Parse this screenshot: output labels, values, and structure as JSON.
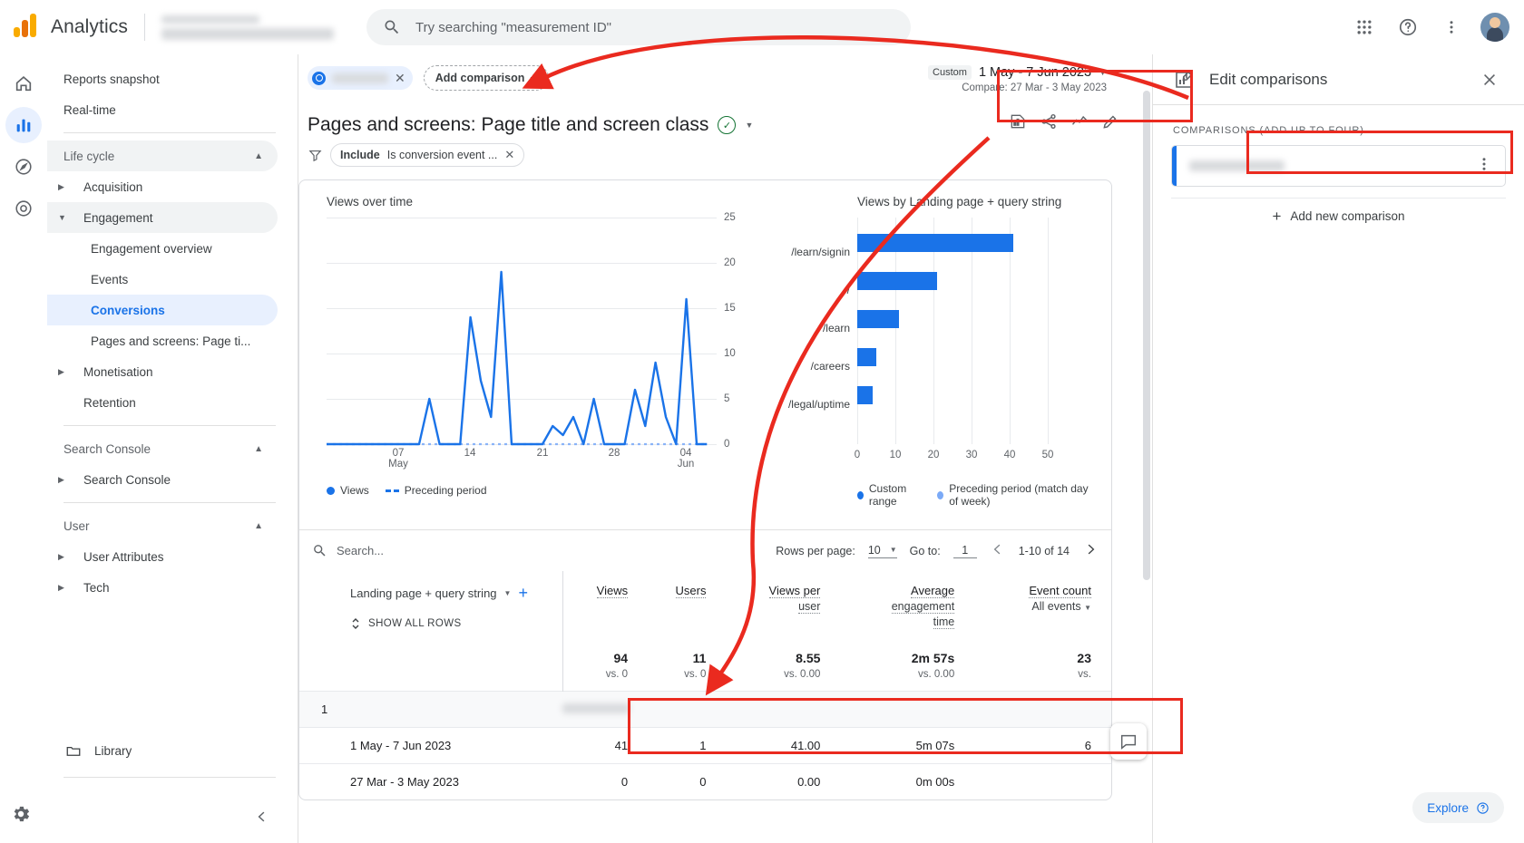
{
  "topbar": {
    "brand": "Analytics",
    "search_placeholder": "Try searching \"measurement ID\"",
    "apps_icon": "apps-grid-icon",
    "help_icon": "help-icon",
    "more_icon": "more-vertical-icon",
    "avatar": "user-avatar"
  },
  "rail": {
    "items": [
      {
        "name": "home",
        "icon": "home-icon"
      },
      {
        "name": "reports",
        "icon": "bar-chart-icon",
        "active": true
      },
      {
        "name": "explore",
        "icon": "explore-icon"
      },
      {
        "name": "advertising",
        "icon": "advertising-icon"
      }
    ],
    "settings_icon": "gear-icon"
  },
  "sidebar": {
    "items": [
      {
        "label": "Reports snapshot",
        "type": "item"
      },
      {
        "label": "Real-time",
        "type": "item"
      },
      {
        "label": "Life cycle",
        "type": "group",
        "expanded": true
      },
      {
        "label": "Acquisition",
        "type": "l1",
        "expanded": false
      },
      {
        "label": "Engagement",
        "type": "l1",
        "expanded": true
      },
      {
        "label": "Engagement overview",
        "type": "sub"
      },
      {
        "label": "Events",
        "type": "sub"
      },
      {
        "label": "Conversions",
        "type": "sub",
        "selected": true
      },
      {
        "label": "Pages and screens: Page ti...",
        "type": "sub"
      },
      {
        "label": "Monetisation",
        "type": "l1",
        "expanded": false
      },
      {
        "label": "Retention",
        "type": "item-indent"
      },
      {
        "label": "Search Console",
        "type": "group",
        "expanded": true
      },
      {
        "label": "Search Console",
        "type": "l1",
        "expanded": false
      },
      {
        "label": "User",
        "type": "group",
        "expanded": true
      },
      {
        "label": "User Attributes",
        "type": "l1",
        "expanded": false
      },
      {
        "label": "Tech",
        "type": "l1",
        "expanded": false
      }
    ],
    "library": "Library",
    "library_icon": "folder-icon",
    "collapse_icon": "chevron-left-icon"
  },
  "comparisons_bar": {
    "chip_close": "✕",
    "add_comparison": "Add comparison"
  },
  "date_range": {
    "custom_label": "Custom",
    "range": "1 May - 7 Jun 2023",
    "compare": "Compare: 27 Mar - 3 May 2023"
  },
  "report": {
    "title": "Pages and screens: Page title and screen class",
    "verified_icon": "verified-check-icon",
    "actions": [
      {
        "name": "insights-icon"
      },
      {
        "name": "share-icon"
      },
      {
        "name": "compare-trend-icon"
      },
      {
        "name": "edit-pencil-icon"
      }
    ],
    "filter": {
      "icon": "filter-icon",
      "prefix": "Include",
      "text": "Is conversion event ...",
      "close": "✕"
    }
  },
  "chart_data": [
    {
      "type": "line",
      "title": "Views over time",
      "xlabel": "",
      "ylabel": "",
      "ylim": [
        0,
        25
      ],
      "yticks": [
        0,
        5,
        10,
        15,
        20,
        25
      ],
      "xticks": [
        "07 May",
        "14",
        "21",
        "28",
        "04 Jun"
      ],
      "grid": true,
      "legend": [
        {
          "label": "Views",
          "style": "solid",
          "color": "#1a73e8"
        },
        {
          "label": "Preceding period",
          "style": "dashed",
          "color": "#1a73e8"
        }
      ],
      "series": [
        {
          "name": "Views",
          "values": [
            0,
            0,
            0,
            0,
            0,
            0,
            0,
            0,
            0,
            0,
            5,
            0,
            0,
            0,
            14,
            7,
            3,
            19,
            0,
            0,
            0,
            0,
            2,
            1,
            3,
            0,
            5,
            0,
            0,
            0,
            6,
            2,
            9,
            3,
            0,
            16,
            0,
            0
          ]
        },
        {
          "name": "Preceding period",
          "values": [
            0,
            0,
            0,
            0,
            0,
            0,
            0,
            0,
            0,
            0,
            0,
            0,
            0,
            0,
            0,
            0,
            0,
            0,
            0,
            0,
            0,
            0,
            0,
            0,
            0,
            0,
            0,
            0,
            0,
            0,
            0,
            0,
            0,
            0,
            0,
            0,
            0,
            0
          ]
        }
      ]
    },
    {
      "type": "bar",
      "orientation": "horizontal",
      "title": "Views by Landing page + query string",
      "categories": [
        "/learn/signin",
        "/",
        "/learn",
        "/careers",
        "/legal/uptime"
      ],
      "values": [
        41,
        21,
        11,
        5,
        4
      ],
      "xticks": [
        0,
        10,
        20,
        30,
        40,
        50
      ],
      "xlim": [
        0,
        50
      ],
      "legend": [
        {
          "label": "Custom range",
          "color": "#1a73e8"
        },
        {
          "label": "Preceding period (match day of week)",
          "color": "#7baaf7"
        }
      ]
    }
  ],
  "table": {
    "search_placeholder": "Search...",
    "search_icon": "search-icon",
    "rows_per_page_label": "Rows per page:",
    "rows_per_page_value": "10",
    "goto_label": "Go to:",
    "goto_value": "1",
    "page_info": "1-10 of 14",
    "prev_icon": "chevron-left-icon",
    "next_icon": "chevron-right-icon",
    "dimension": "Landing page + query string",
    "dimension_add_icon": "plus-icon",
    "show_all_rows": "SHOW ALL ROWS",
    "show_all_icon": "expand-vertical-icon",
    "columns": [
      {
        "label": "Views",
        "sub": ""
      },
      {
        "label": "Users",
        "sub": ""
      },
      {
        "label": "Views per",
        "sub": "user"
      },
      {
        "label": "Average",
        "sub": "engagement",
        "sub2": "time"
      },
      {
        "label": "Event count",
        "sub": "All events",
        "dropdown": true
      }
    ],
    "summary": {
      "views": "94",
      "views_vs": "vs. 0",
      "users": "11",
      "users_vs": "vs. 0",
      "views_per_user": "8.55",
      "views_per_user_vs": "vs. 0.00",
      "avg_engagement": "2m 57s",
      "avg_engagement_vs": "vs. 0.00",
      "event_count": "23",
      "event_count_vs": "vs."
    },
    "rows": [
      {
        "index": "1",
        "label": "",
        "blurred": true,
        "group": true,
        "views": "",
        "users": "",
        "views_per_user": "",
        "avg_engagement": "",
        "event_count": ""
      },
      {
        "index": "",
        "label": "1 May - 7 Jun 2023",
        "blurred": false,
        "group": false,
        "views": "41",
        "users": "1",
        "views_per_user": "41.00",
        "avg_engagement": "5m 07s",
        "event_count": "6"
      },
      {
        "index": "",
        "label": "27 Mar - 3 May 2023",
        "blurred": false,
        "group": false,
        "views": "0",
        "users": "0",
        "views_per_user": "0.00",
        "avg_engagement": "0m 00s",
        "event_count": ""
      }
    ]
  },
  "panel": {
    "icon": "edit-comparisons-icon",
    "title": "Edit comparisons",
    "close_icon": "close-icon",
    "section_label": "COMPARISONS (ADD UP TO FOUR)",
    "comparison_kebab": "more-vertical-icon",
    "add_new": "Add new comparison",
    "add_new_icon": "plus-icon"
  },
  "footer": {
    "explore": "Explore",
    "explore_help_icon": "help-circle-icon",
    "feedback_icon": "feedback-icon"
  },
  "colors": {
    "brand_blue": "#1a73e8",
    "light_blue": "#7baaf7",
    "annotation_red": "#ea2a1f",
    "green": "#137333"
  }
}
